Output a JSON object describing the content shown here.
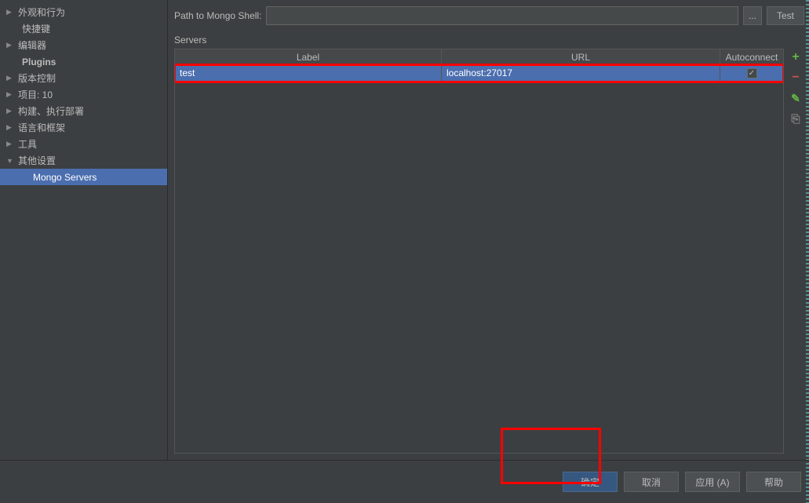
{
  "sidebar": {
    "items": [
      {
        "label": "外观和行为",
        "arrow": "collapsed"
      },
      {
        "label": "快捷键",
        "arrow": "none",
        "indent": 1
      },
      {
        "label": "编辑器",
        "arrow": "collapsed"
      },
      {
        "label": "Plugins",
        "arrow": "none",
        "indent": 1,
        "bold": true
      },
      {
        "label": "版本控制",
        "arrow": "collapsed"
      },
      {
        "label": "项目: 10",
        "arrow": "collapsed"
      },
      {
        "label": "构建、执行部署",
        "arrow": "collapsed"
      },
      {
        "label": "语言和框架",
        "arrow": "collapsed"
      },
      {
        "label": "工具",
        "arrow": "collapsed"
      },
      {
        "label": "其他设置",
        "arrow": "expanded"
      },
      {
        "label": "Mongo Servers",
        "arrow": "none",
        "indent": 2,
        "selected": true
      }
    ]
  },
  "content": {
    "path_label": "Path to Mongo Shell:",
    "path_value": "",
    "browse_label": "...",
    "test_label": "Test",
    "servers_label": "Servers",
    "table": {
      "headers": {
        "label": "Label",
        "url": "URL",
        "autoconnect": "Autoconnect"
      },
      "rows": [
        {
          "label": "test",
          "url": "localhost:27017",
          "autoconnect": true
        }
      ]
    },
    "toolbar": {
      "add": "+",
      "remove": "−",
      "edit": "✎",
      "copy": "⎘"
    }
  },
  "footer": {
    "ok": "确定",
    "cancel": "取消",
    "apply": "应用 (A)",
    "help": "帮助"
  }
}
